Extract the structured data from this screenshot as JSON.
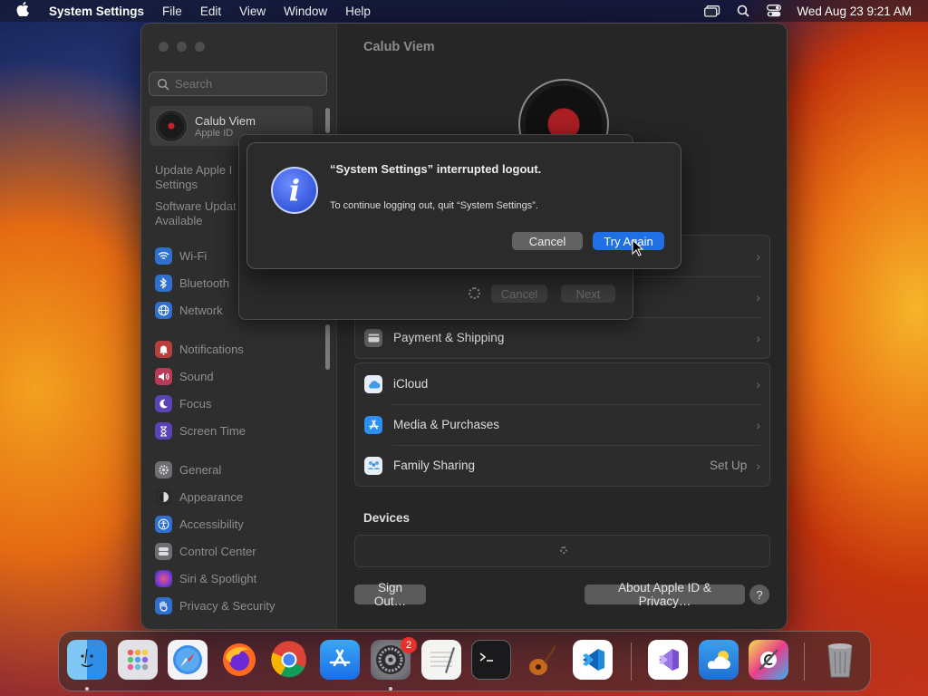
{
  "menubar": {
    "app_name": "System Settings",
    "menus": [
      "File",
      "Edit",
      "View",
      "Window",
      "Help"
    ],
    "datetime": "Wed Aug 23  9:21 AM"
  },
  "sidebar": {
    "search_placeholder": "Search",
    "account_name": "Calub Viem",
    "account_sub": "Apple ID",
    "update_line1": "Update Apple I",
    "update_line2": "Settings",
    "software_line1": "Software Updat",
    "software_line2": "Available",
    "items": [
      {
        "label": "Wi-Fi",
        "icon": "wifi-icon",
        "color": "#2f7be6"
      },
      {
        "label": "Bluetooth",
        "icon": "bluetooth-icon",
        "color": "#2f7be6"
      },
      {
        "label": "Network",
        "icon": "globe-icon",
        "color": "#2f7be6"
      },
      {
        "label": "Notifications",
        "icon": "bell-icon",
        "color": "#e24540"
      },
      {
        "label": "Sound",
        "icon": "speaker-icon",
        "color": "#e24563"
      },
      {
        "label": "Focus",
        "icon": "moon-icon",
        "color": "#6a4fd8"
      },
      {
        "label": "Screen Time",
        "icon": "hourglass-icon",
        "color": "#6a4fd8"
      },
      {
        "label": "General",
        "icon": "gear-icon",
        "color": "#8e8e93"
      },
      {
        "label": "Appearance",
        "icon": "appearance-icon",
        "color": "#3a3a3a"
      },
      {
        "label": "Accessibility",
        "icon": "accessibility-icon",
        "color": "#2f7be6"
      },
      {
        "label": "Control Center",
        "icon": "control-center-icon",
        "color": "#8e8e93"
      },
      {
        "label": "Siri & Spotlight",
        "icon": "siri-icon",
        "color": "#c03ad0"
      },
      {
        "label": "Privacy & Security",
        "icon": "hand-icon",
        "color": "#2f7be6"
      }
    ]
  },
  "main": {
    "title": "Calub Viem",
    "group1_last": "Payment & Shipping",
    "group2": [
      {
        "label": "iCloud",
        "icon": "icloud-icon"
      },
      {
        "label": "Media & Purchases",
        "icon": "app-store-icon"
      },
      {
        "label": "Family Sharing",
        "icon": "family-icon",
        "value": "Set Up"
      }
    ],
    "devices_title": "Devices",
    "sign_out": "Sign Out…",
    "about": "About Apple ID & Privacy…",
    "help": "?"
  },
  "sheet": {
    "cancel": "Cancel",
    "next": "Next"
  },
  "alert": {
    "title": "“System Settings” interrupted logout.",
    "message": "To continue logging out, quit “System Settings”.",
    "cancel": "Cancel",
    "try_again": "Try Again",
    "icon": "info-icon",
    "accent": "#1f6fe5"
  },
  "dock": {
    "apps": [
      "Finder",
      "Launchpad",
      "Safari",
      "Firefox",
      "Chrome",
      "App Store",
      "System Settings",
      "TextEdit",
      "Terminal",
      "GarageBand",
      "Visual Studio Code",
      "Visual Studio",
      "Weather",
      "Xcode Tool",
      "Trash"
    ],
    "settings_badge": "2"
  }
}
